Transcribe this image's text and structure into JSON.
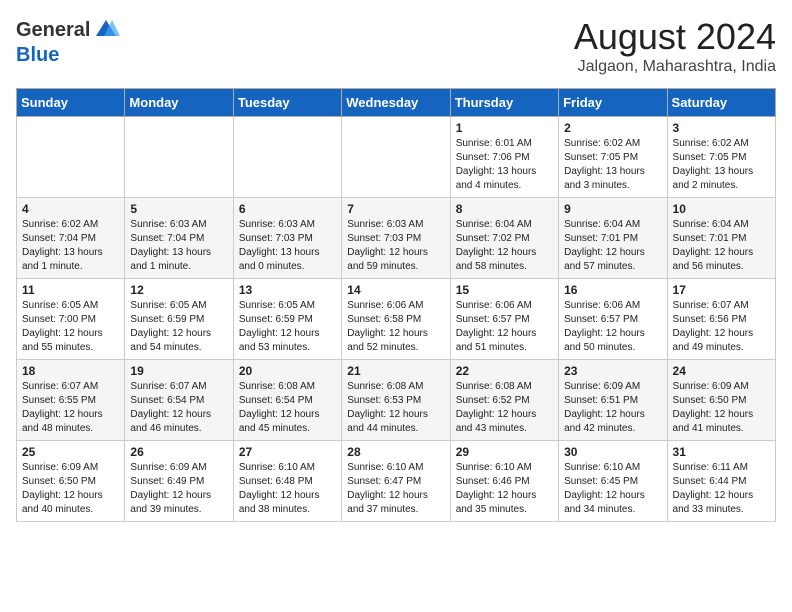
{
  "header": {
    "logo_general": "General",
    "logo_blue": "Blue",
    "month_year": "August 2024",
    "location": "Jalgaon, Maharashtra, India"
  },
  "weekdays": [
    "Sunday",
    "Monday",
    "Tuesday",
    "Wednesday",
    "Thursday",
    "Friday",
    "Saturday"
  ],
  "weeks": [
    [
      null,
      null,
      null,
      null,
      {
        "day": "1",
        "sunrise": "6:01 AM",
        "sunset": "7:06 PM",
        "daylight": "13 hours and 4 minutes."
      },
      {
        "day": "2",
        "sunrise": "6:02 AM",
        "sunset": "7:05 PM",
        "daylight": "13 hours and 3 minutes."
      },
      {
        "day": "3",
        "sunrise": "6:02 AM",
        "sunset": "7:05 PM",
        "daylight": "13 hours and 2 minutes."
      }
    ],
    [
      {
        "day": "4",
        "sunrise": "6:02 AM",
        "sunset": "7:04 PM",
        "daylight": "13 hours and 1 minute."
      },
      {
        "day": "5",
        "sunrise": "6:03 AM",
        "sunset": "7:04 PM",
        "daylight": "13 hours and 1 minute."
      },
      {
        "day": "6",
        "sunrise": "6:03 AM",
        "sunset": "7:03 PM",
        "daylight": "13 hours and 0 minutes."
      },
      {
        "day": "7",
        "sunrise": "6:03 AM",
        "sunset": "7:03 PM",
        "daylight": "12 hours and 59 minutes."
      },
      {
        "day": "8",
        "sunrise": "6:04 AM",
        "sunset": "7:02 PM",
        "daylight": "12 hours and 58 minutes."
      },
      {
        "day": "9",
        "sunrise": "6:04 AM",
        "sunset": "7:01 PM",
        "daylight": "12 hours and 57 minutes."
      },
      {
        "day": "10",
        "sunrise": "6:04 AM",
        "sunset": "7:01 PM",
        "daylight": "12 hours and 56 minutes."
      }
    ],
    [
      {
        "day": "11",
        "sunrise": "6:05 AM",
        "sunset": "7:00 PM",
        "daylight": "12 hours and 55 minutes."
      },
      {
        "day": "12",
        "sunrise": "6:05 AM",
        "sunset": "6:59 PM",
        "daylight": "12 hours and 54 minutes."
      },
      {
        "day": "13",
        "sunrise": "6:05 AM",
        "sunset": "6:59 PM",
        "daylight": "12 hours and 53 minutes."
      },
      {
        "day": "14",
        "sunrise": "6:06 AM",
        "sunset": "6:58 PM",
        "daylight": "12 hours and 52 minutes."
      },
      {
        "day": "15",
        "sunrise": "6:06 AM",
        "sunset": "6:57 PM",
        "daylight": "12 hours and 51 minutes."
      },
      {
        "day": "16",
        "sunrise": "6:06 AM",
        "sunset": "6:57 PM",
        "daylight": "12 hours and 50 minutes."
      },
      {
        "day": "17",
        "sunrise": "6:07 AM",
        "sunset": "6:56 PM",
        "daylight": "12 hours and 49 minutes."
      }
    ],
    [
      {
        "day": "18",
        "sunrise": "6:07 AM",
        "sunset": "6:55 PM",
        "daylight": "12 hours and 48 minutes."
      },
      {
        "day": "19",
        "sunrise": "6:07 AM",
        "sunset": "6:54 PM",
        "daylight": "12 hours and 46 minutes."
      },
      {
        "day": "20",
        "sunrise": "6:08 AM",
        "sunset": "6:54 PM",
        "daylight": "12 hours and 45 minutes."
      },
      {
        "day": "21",
        "sunrise": "6:08 AM",
        "sunset": "6:53 PM",
        "daylight": "12 hours and 44 minutes."
      },
      {
        "day": "22",
        "sunrise": "6:08 AM",
        "sunset": "6:52 PM",
        "daylight": "12 hours and 43 minutes."
      },
      {
        "day": "23",
        "sunrise": "6:09 AM",
        "sunset": "6:51 PM",
        "daylight": "12 hours and 42 minutes."
      },
      {
        "day": "24",
        "sunrise": "6:09 AM",
        "sunset": "6:50 PM",
        "daylight": "12 hours and 41 minutes."
      }
    ],
    [
      {
        "day": "25",
        "sunrise": "6:09 AM",
        "sunset": "6:50 PM",
        "daylight": "12 hours and 40 minutes."
      },
      {
        "day": "26",
        "sunrise": "6:09 AM",
        "sunset": "6:49 PM",
        "daylight": "12 hours and 39 minutes."
      },
      {
        "day": "27",
        "sunrise": "6:10 AM",
        "sunset": "6:48 PM",
        "daylight": "12 hours and 38 minutes."
      },
      {
        "day": "28",
        "sunrise": "6:10 AM",
        "sunset": "6:47 PM",
        "daylight": "12 hours and 37 minutes."
      },
      {
        "day": "29",
        "sunrise": "6:10 AM",
        "sunset": "6:46 PM",
        "daylight": "12 hours and 35 minutes."
      },
      {
        "day": "30",
        "sunrise": "6:10 AM",
        "sunset": "6:45 PM",
        "daylight": "12 hours and 34 minutes."
      },
      {
        "day": "31",
        "sunrise": "6:11 AM",
        "sunset": "6:44 PM",
        "daylight": "12 hours and 33 minutes."
      }
    ]
  ]
}
